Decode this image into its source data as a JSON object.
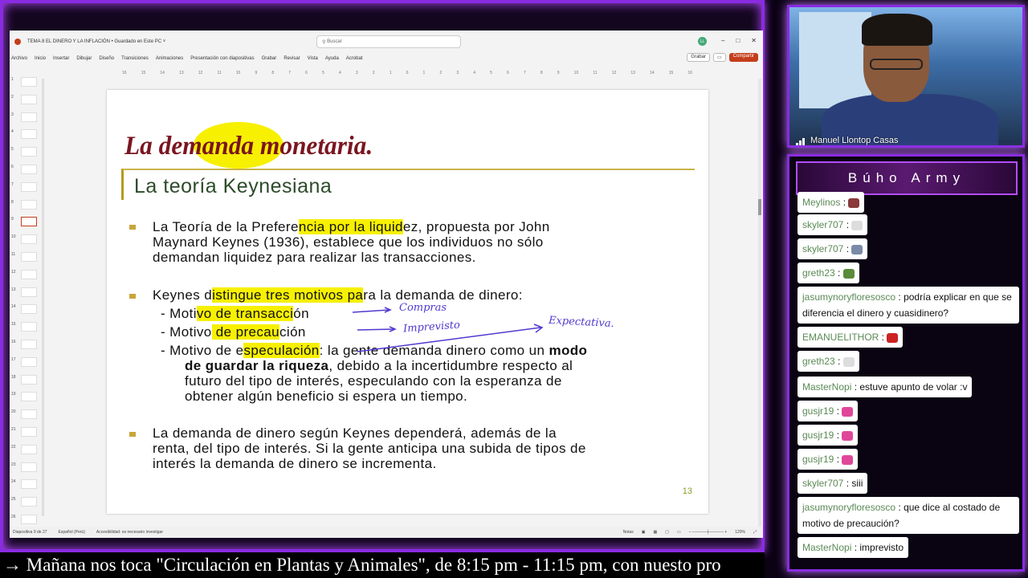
{
  "ppt": {
    "doc_title": "TEMA 8 EL DINERO Y LA INFLACIÓN • Guardado en Este PC ˅",
    "search_placeholder": "Buscar",
    "avatar_initials": "LL",
    "menu": [
      "Archivo",
      "Inicio",
      "Insertar",
      "Dibujar",
      "Diseño",
      "Transiciones",
      "Animaciones",
      "Presentación con diapositivas",
      "Grabar",
      "Revisar",
      "Vista",
      "Ayuda",
      "Acrobat"
    ],
    "grabar_label": "Grabar",
    "compartir_label": "Compartir",
    "ruler": [
      "16",
      "15",
      "14",
      "13",
      "12",
      "11",
      "10",
      "9",
      "8",
      "7",
      "6",
      "5",
      "4",
      "3",
      "2",
      "1",
      "0",
      "1",
      "2",
      "3",
      "4",
      "5",
      "6",
      "7",
      "8",
      "9",
      "10",
      "11",
      "12",
      "13",
      "14",
      "15",
      "16"
    ],
    "thumb_numbers": [
      "1",
      "2",
      "3",
      "4",
      "5",
      "6",
      "7",
      "8",
      "9",
      "10",
      "11",
      "12",
      "13",
      "14",
      "15",
      "16",
      "17",
      "18",
      "19",
      "20",
      "21",
      "22",
      "23",
      "24",
      "25",
      "26"
    ],
    "status": {
      "slide_info": "Diapositiva 9 de 27",
      "language": "Español (Perú)",
      "accessibility": "Accesibilidad: es necesario investigar",
      "notes": "Notas",
      "zoom": "120%"
    }
  },
  "slide": {
    "title": "La demanda monetaria.",
    "subtitle": "La teoría Keynesiana",
    "p1_a": "La Teoría de la Prefere",
    "p1_hl": "ncia por la liquid",
    "p1_b": "ez, propuesta por John",
    "p1_line2": "Maynard Keynes (1936), establece que los individuos no sólo",
    "p1_line3": "demandan liquidez para realizar las transacciones.",
    "p2_a": "Keynes d",
    "p2_hl": "istingue tres motivos pa",
    "p2_b": "ra la demanda de dinero:",
    "m1_a": "- Moti",
    "m1_hl": "vo de transacci",
    "m1_b": "ón",
    "m2_a": "- Motivo",
    "m2_hl": " de precau",
    "m2_b": "ción",
    "m3_a": "- Motivo de e",
    "m3_hl": "speculación",
    "m3_b": ": la gente demanda dinero como un ",
    "m3_bold": "modo",
    "m3_line2_bold": "de guardar la riqueza",
    "m3_line2": ", debido a la incertidumbre respecto al",
    "m3_line3": "futuro del tipo de interés, especulando con la esperanza de",
    "m3_line4": "obtener algún beneficio si espera un tiempo.",
    "p3_line1": "La demanda de dinero según Keynes dependerá, además de la",
    "p3_line2": "renta, del tipo de interés. Si la gente anticipa una subida de tipos de",
    "p3_line3": "interés la demanda de dinero se incrementa.",
    "hand_compras": "Compras",
    "hand_imprevisto": "Imprevisto",
    "hand_expectativa": "Expectativa.",
    "page_number": "13"
  },
  "camera": {
    "name": "Manuel Llontop Casas"
  },
  "chat": {
    "header": "Búho Army",
    "messages": [
      {
        "user": "Meylinos",
        "text": ""
      },
      {
        "user": "skyler707",
        "text": ""
      },
      {
        "user": "skyler707",
        "text": ""
      },
      {
        "user": "greth23",
        "text": ""
      },
      {
        "user": "jasumynoryfloresosco",
        "text": "podría explicar en que se diferencia el dinero y cuasidinero?"
      },
      {
        "user": "EMANUELITHOR",
        "text": ""
      },
      {
        "user": "greth23",
        "text": ""
      },
      {
        "user": "MasterNopi",
        "text": "estuve apunto de volar :v"
      },
      {
        "user": "gusjr19",
        "text": ""
      },
      {
        "user": "gusjr19",
        "text": ""
      },
      {
        "user": "gusjr19",
        "text": ""
      },
      {
        "user": "skyler707",
        "text": "siii"
      },
      {
        "user": "jasumynoryfloresosco",
        "text": "que dice al costado de motivo de precaución?"
      },
      {
        "user": "MasterNopi",
        "text": "imprevisto"
      }
    ]
  },
  "ticker": "→  Mañana nos toca \"Circulación en Plantas y Animales\", de 8:15 pm - 11:15 pm, con nuesto pro",
  "colors": {
    "accent": "#8a2be2",
    "highlight": "#f7f000",
    "title": "#7a1520",
    "ink": "#4f3ad0"
  }
}
